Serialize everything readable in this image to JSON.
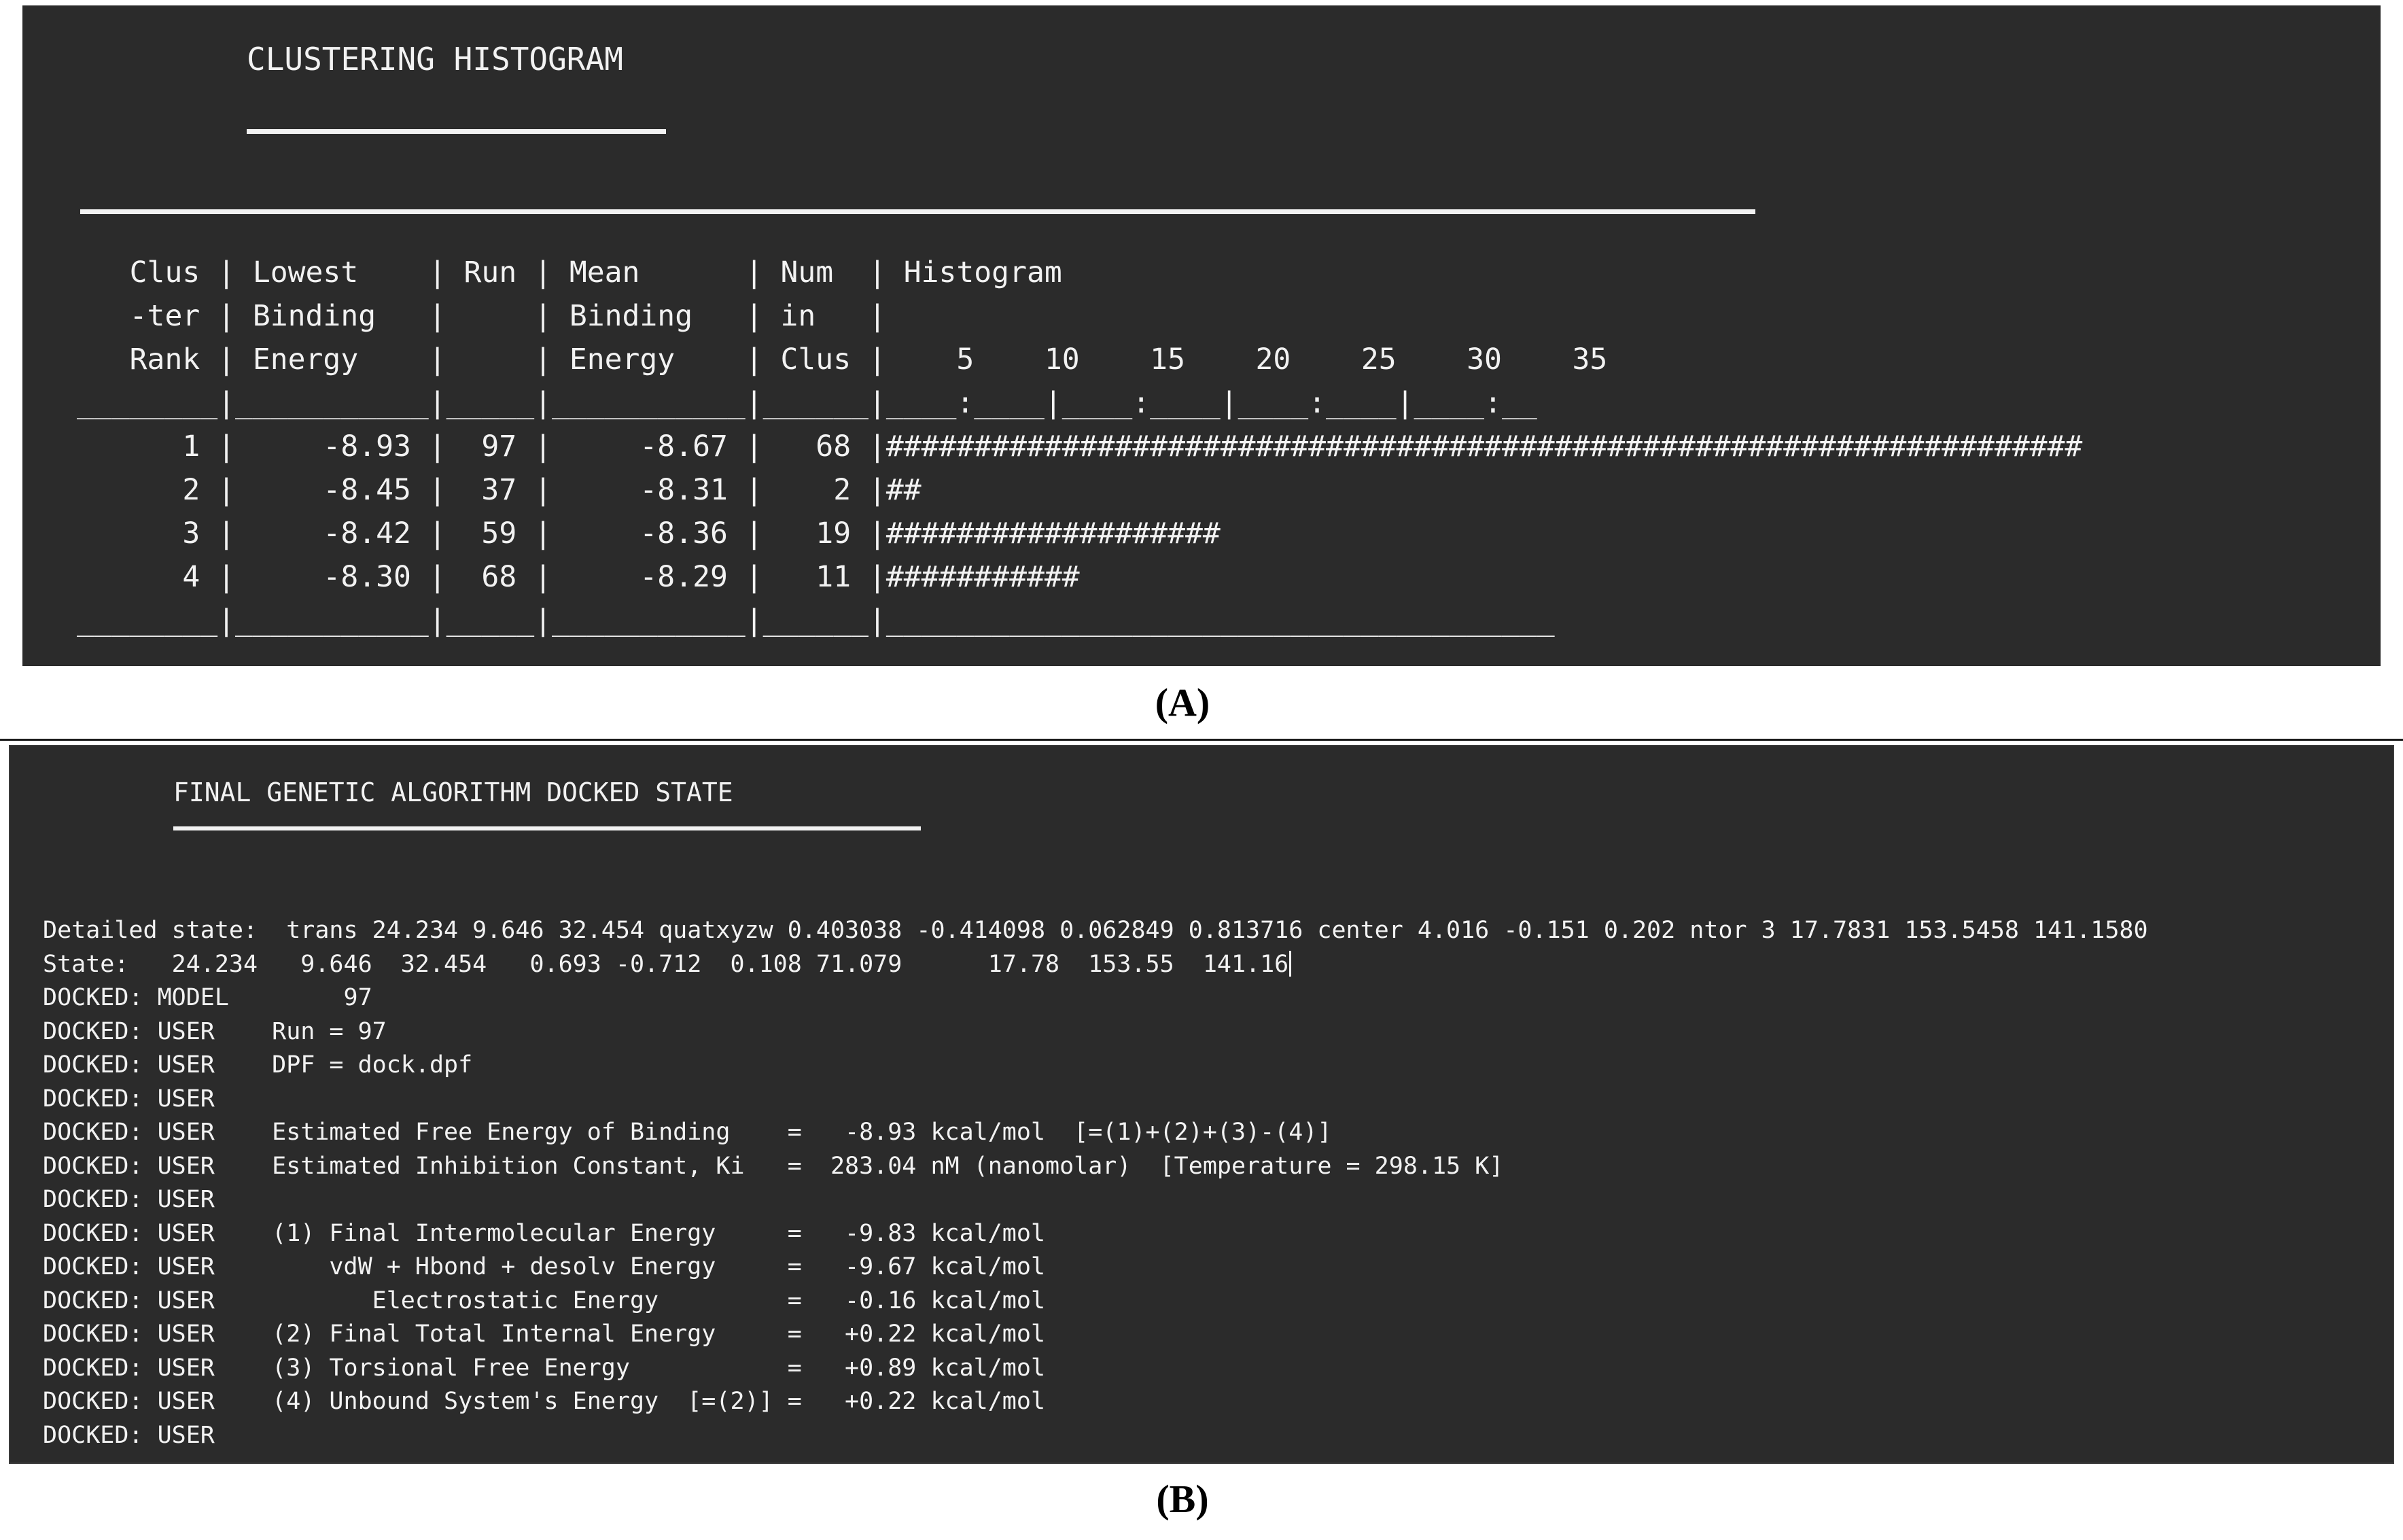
{
  "panel_a": {
    "label": "(A)",
    "title": "CLUSTERING HISTOGRAM",
    "table": {
      "headers": [
        [
          "Clus",
          "Lowest",
          "Run",
          "Mean",
          "Num",
          "Histogram"
        ],
        [
          "-ter",
          "Binding",
          "",
          "Binding",
          "in",
          ""
        ],
        [
          "Rank",
          "Energy",
          "",
          "Energy",
          "Clus",
          ""
        ]
      ],
      "axis_ticks": [
        "5",
        "10",
        "15",
        "20",
        "25",
        "30",
        "35"
      ],
      "axis_ruler": "____:____|____:____|____:____|____:__",
      "rows": [
        {
          "cluster_rank": "1",
          "lowest_binding_energy": "-8.93",
          "run": "97",
          "mean_binding_energy": "-8.67",
          "num_in_clus": "68"
        },
        {
          "cluster_rank": "2",
          "lowest_binding_energy": "-8.45",
          "run": "37",
          "mean_binding_energy": "-8.31",
          "num_in_clus": "2"
        },
        {
          "cluster_rank": "3",
          "lowest_binding_energy": "-8.42",
          "run": "59",
          "mean_binding_energy": "-8.36",
          "num_in_clus": "19"
        },
        {
          "cluster_rank": "4",
          "lowest_binding_energy": "-8.30",
          "run": "68",
          "mean_binding_energy": "-8.29",
          "num_in_clus": "11"
        }
      ],
      "rendered": [
        "   Clus | Lowest    | Run | Mean      | Num  | Histogram",
        "   -ter | Binding   |     | Binding   | in   |",
        "   Rank | Energy    |     | Energy    | Clus |    5    10    15    20    25    30    35",
        "________|___________|_____|___________|______|____:____|____:____|____:____|____:__",
        "      1 |     -8.93 |  97 |     -8.67 |   68 |####################################################################",
        "      2 |     -8.45 |  37 |     -8.31 |    2 |##",
        "      3 |     -8.42 |  59 |     -8.36 |   19 |###################",
        "      4 |     -8.30 |  68 |     -8.29 |   11 |###########",
        "________|___________|_____|___________|______|______________________________________"
      ]
    }
  },
  "panel_b": {
    "label": "(B)",
    "title": "FINAL GENETIC ALGORITHM DOCKED STATE",
    "detailed_state": "Detailed state:  trans 24.234 9.646 32.454 quatxyzw 0.403038 -0.414098 0.062849 0.813716 center 4.016 -0.151 0.202 ntor 3 17.7831 153.5458 141.1580",
    "state": "State:   24.234   9.646  32.454   0.693 -0.712  0.108 71.079      17.78  153.55  141.16",
    "docked_lines": [
      "DOCKED: MODEL        97",
      "DOCKED: USER    Run = 97",
      "DOCKED: USER    DPF = dock.dpf",
      "DOCKED: USER",
      "DOCKED: USER    Estimated Free Energy of Binding    =   -8.93 kcal/mol  [=(1)+(2)+(3)-(4)]",
      "DOCKED: USER    Estimated Inhibition Constant, Ki   =  283.04 nM (nanomolar)  [Temperature = 298.15 K]",
      "DOCKED: USER",
      "DOCKED: USER    (1) Final Intermolecular Energy     =   -9.83 kcal/mol",
      "DOCKED: USER        vdW + Hbond + desolv Energy     =   -9.67 kcal/mol",
      "DOCKED: USER           Electrostatic Energy         =   -0.16 kcal/mol",
      "DOCKED: USER    (2) Final Total Internal Energy     =   +0.22 kcal/mol",
      "DOCKED: USER    (3) Torsional Free Energy           =   +0.89 kcal/mol",
      "DOCKED: USER    (4) Unbound System's Energy  [=(2)] =   +0.22 kcal/mol",
      "DOCKED: USER"
    ],
    "values": {
      "model": "97",
      "run": "97",
      "dpf": "dock.dpf",
      "estimated_free_energy_of_binding": "-8.93 kcal/mol",
      "estimated_inhibition_constant_ki": "283.04 nM (nanomolar)",
      "temperature": "298.15 K",
      "final_intermolecular_energy": "-9.83 kcal/mol",
      "vdw_hbond_desolv_energy": "-9.67 kcal/mol",
      "electrostatic_energy": "-0.16 kcal/mol",
      "final_total_internal_energy": "+0.22 kcal/mol",
      "torsional_free_energy": "+0.89 kcal/mol",
      "unbound_systems_energy": "+0.22 kcal/mol"
    }
  },
  "chart_data": {
    "type": "bar",
    "title": "CLUSTERING HISTOGRAM",
    "xlabel": "Number in Cluster",
    "ylabel": "Cluster Rank",
    "categories": [
      "1",
      "2",
      "3",
      "4"
    ],
    "values": [
      68,
      2,
      19,
      11
    ],
    "x_tick_labels": [
      "5",
      "10",
      "15",
      "20",
      "25",
      "30",
      "35"
    ],
    "xlim": [
      0,
      68
    ],
    "grid": false,
    "legend": "none",
    "series": [
      {
        "name": "Num in Clus",
        "values": [
          68,
          2,
          19,
          11
        ]
      },
      {
        "name": "Lowest Binding Energy (kcal/mol)",
        "values": [
          -8.93,
          -8.45,
          -8.42,
          -8.3
        ]
      },
      {
        "name": "Mean Binding Energy (kcal/mol)",
        "values": [
          -8.67,
          -8.31,
          -8.36,
          -8.29
        ]
      },
      {
        "name": "Run",
        "values": [
          97,
          37,
          59,
          68
        ]
      }
    ]
  },
  "colors": {
    "terminal_background": "#2b2b2b",
    "terminal_text": "#f2f2f2",
    "page_background": "#ffffff",
    "label_text": "#000000"
  }
}
